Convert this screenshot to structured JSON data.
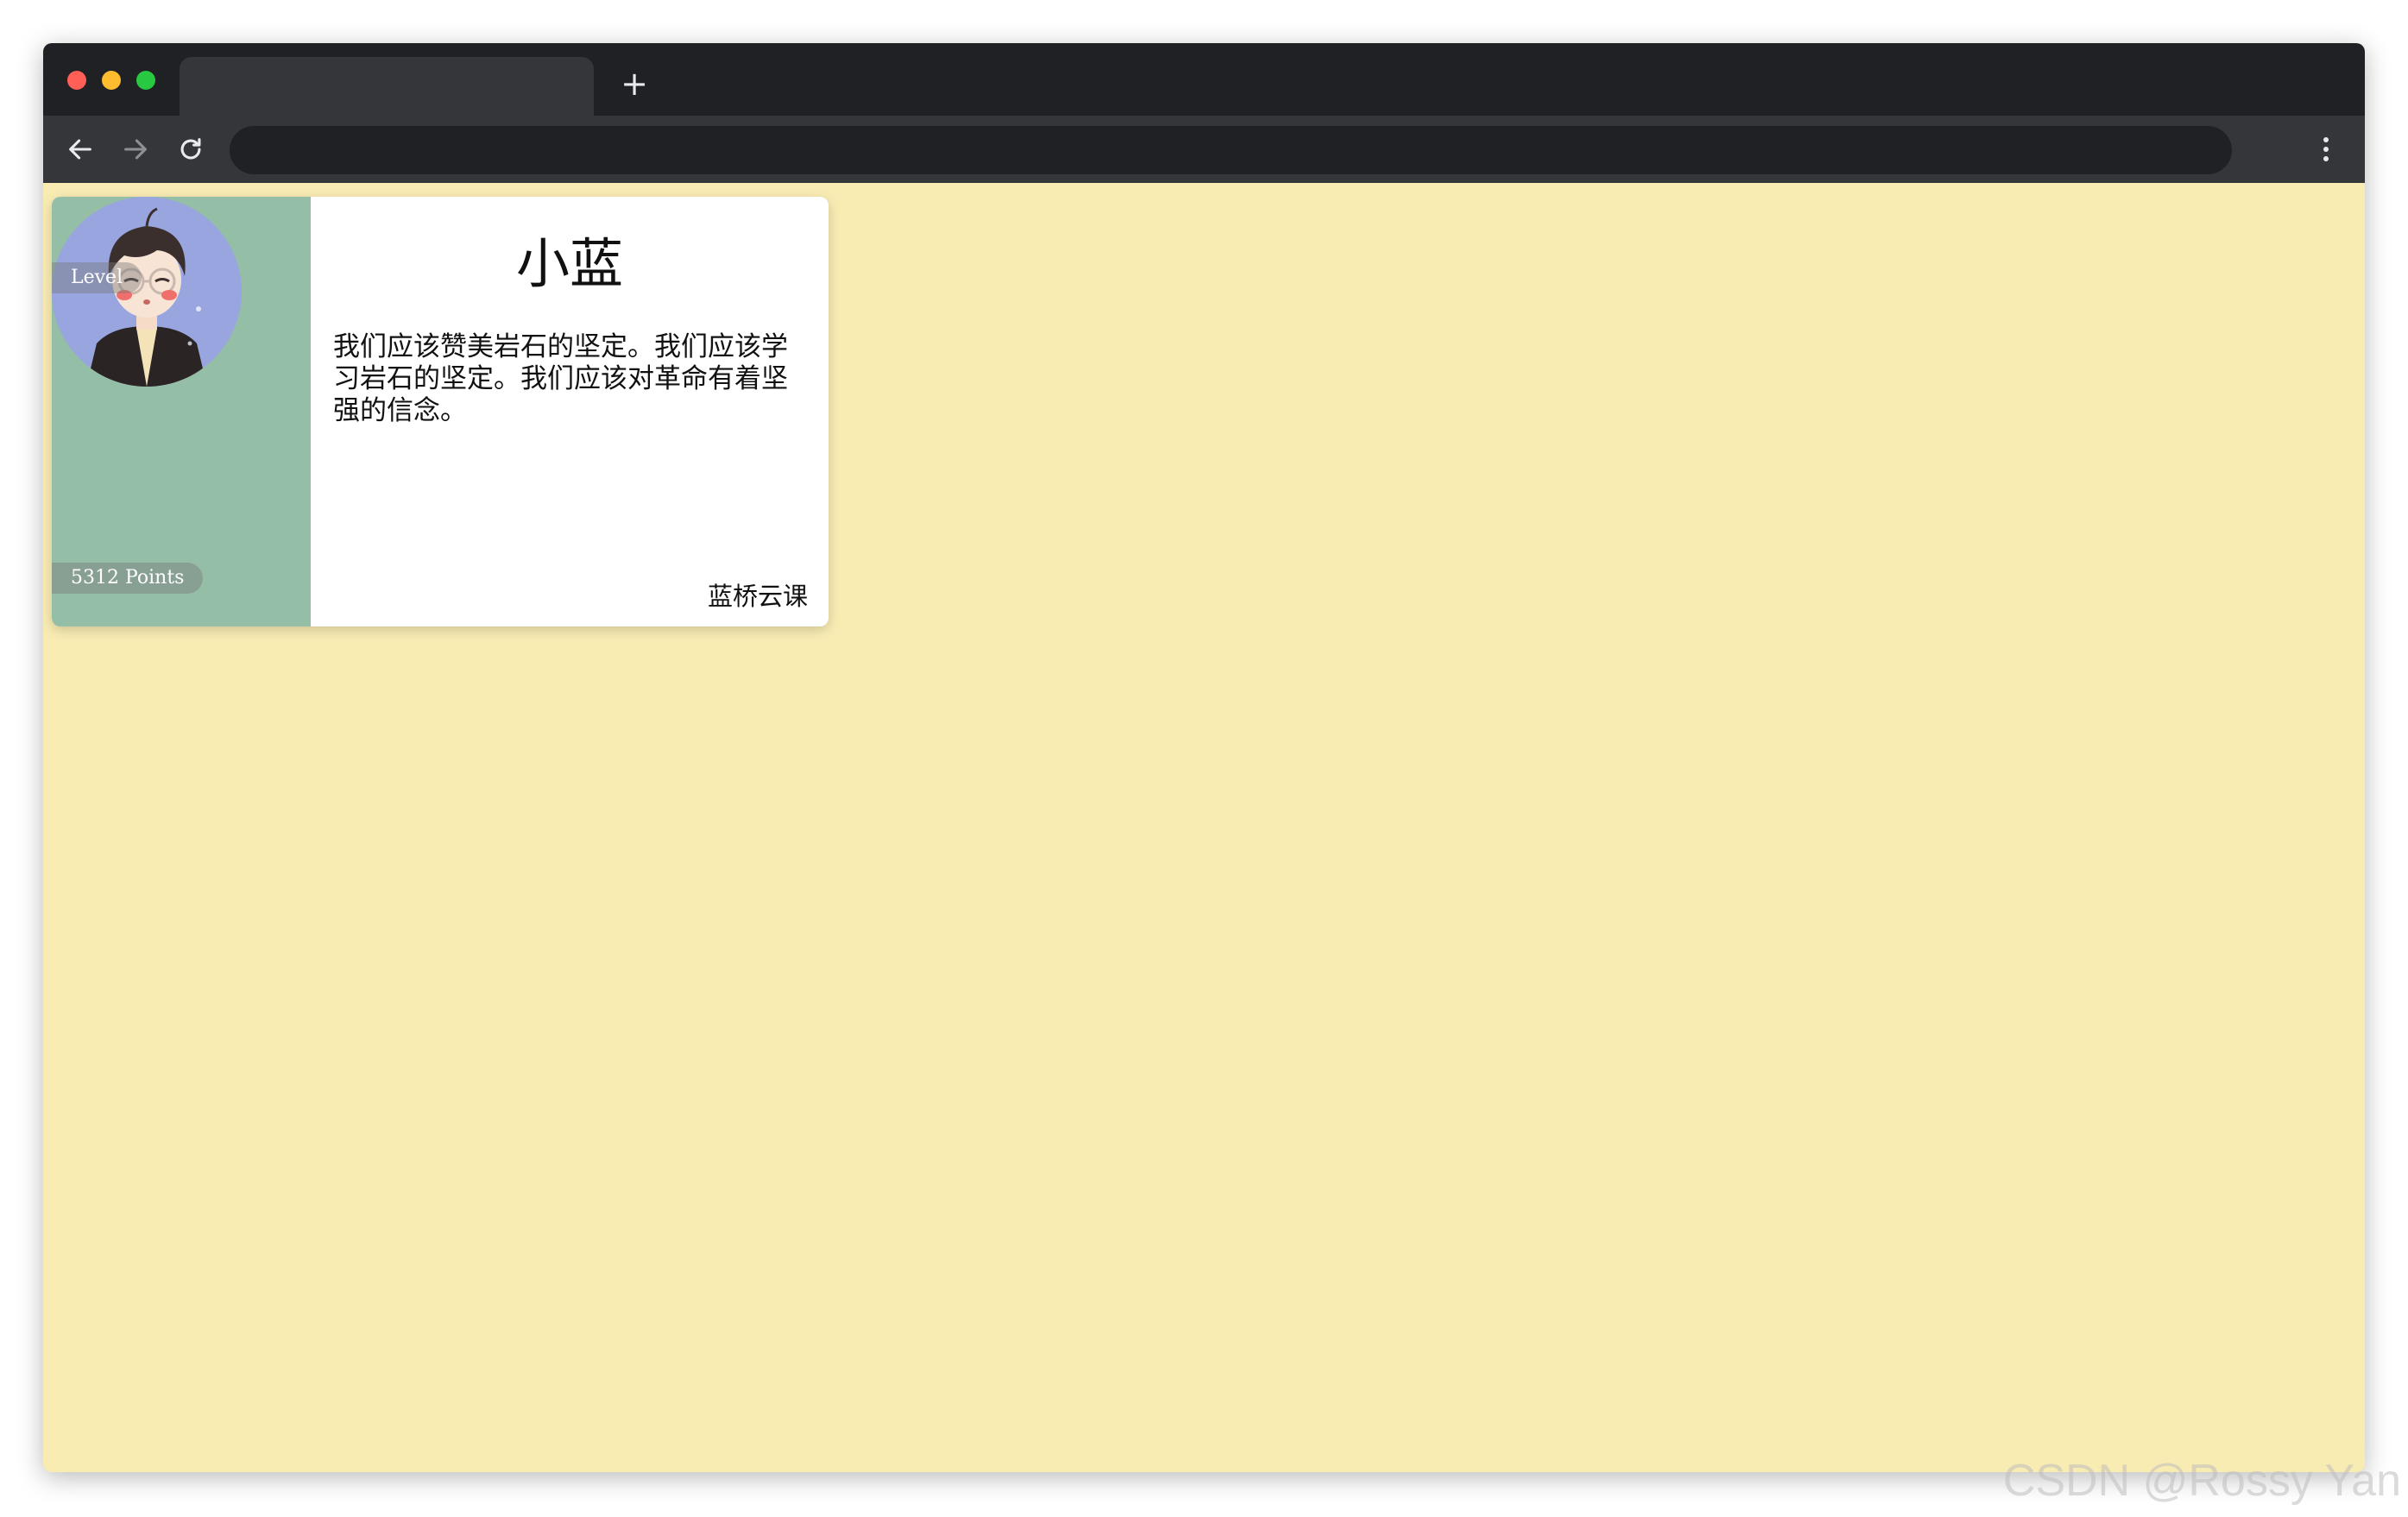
{
  "browser": {
    "tab_title": "",
    "new_tab_label": "+",
    "address": "",
    "icons": {
      "back": "arrow-left-icon",
      "forward": "arrow-right-icon",
      "reload": "reload-icon",
      "menu": "kebab-menu-icon",
      "new_tab": "plus-icon"
    }
  },
  "card": {
    "level_label": "Level",
    "points_label": "5312 Points",
    "name": "小蓝",
    "description": "我们应该赞美岩石的坚定。我们应该学习岩石的坚定。我们应该对革命有着坚强的信念。",
    "signature": "蓝桥云课",
    "colors": {
      "left_panel": "#95bea7",
      "avatar_bg": "#98a5df",
      "page_bg": "#f9ecb3"
    }
  },
  "watermark": "CSDN @Rossy Yan"
}
